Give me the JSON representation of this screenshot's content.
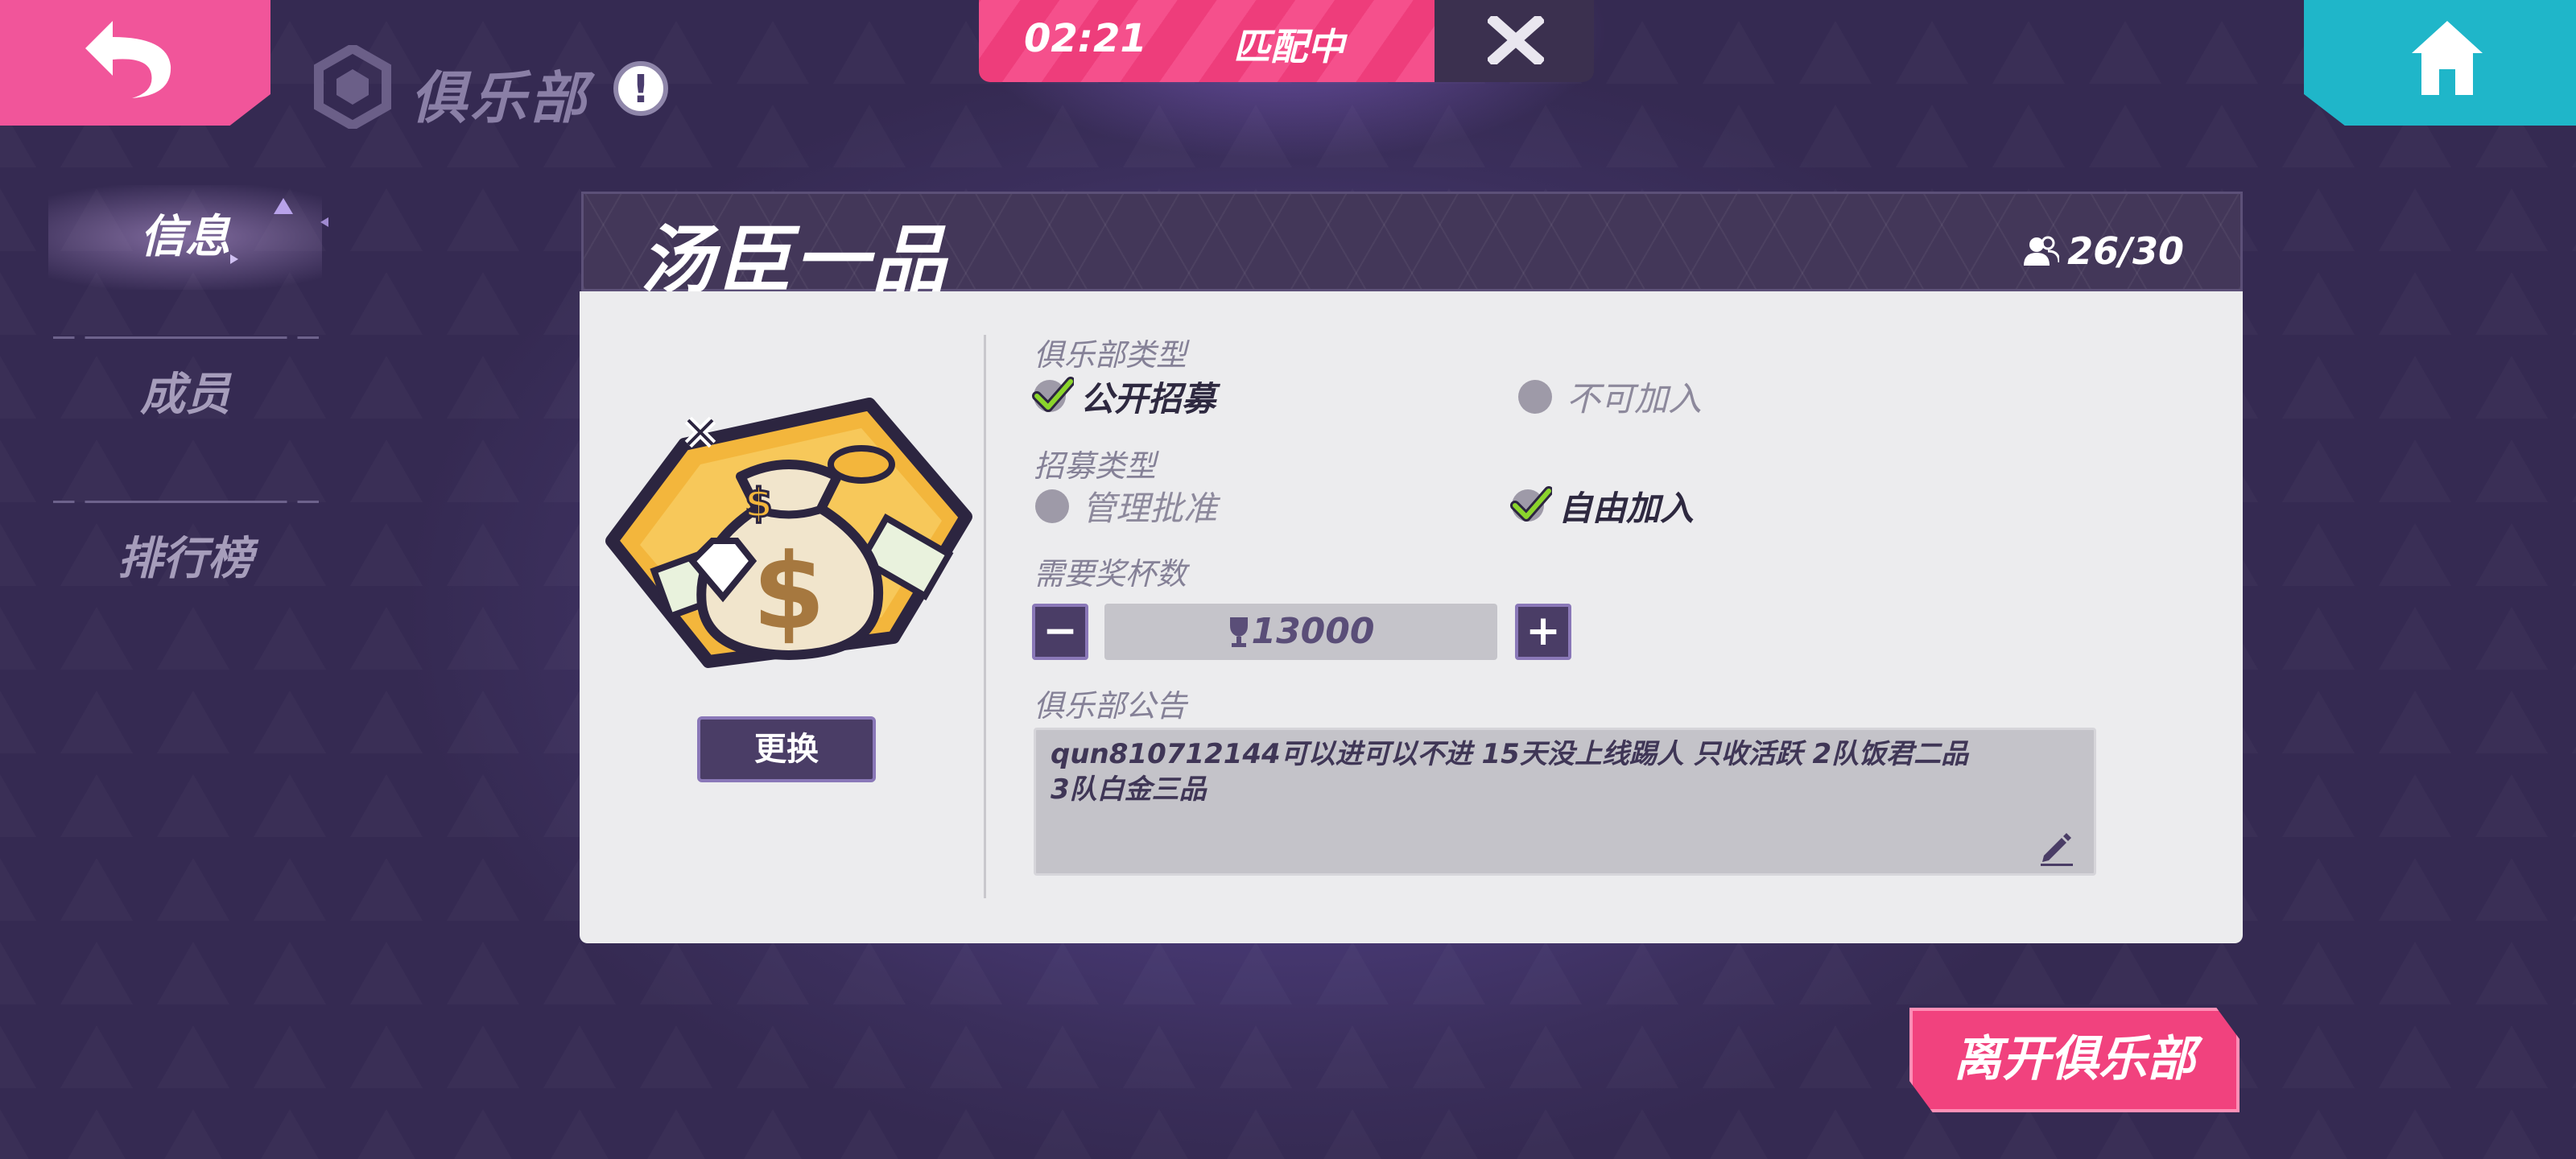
{
  "header": {
    "title": "俱乐部",
    "info_glyph": "!"
  },
  "match": {
    "time": "02:21",
    "status": "匹配中",
    "close_glyph": "✕"
  },
  "sidebar": {
    "items": [
      {
        "label": "信息",
        "active": true
      },
      {
        "label": "成员",
        "active": false
      },
      {
        "label": "排行榜",
        "active": false
      }
    ]
  },
  "club": {
    "name": "汤臣一品",
    "members": "26/30",
    "change_label": "更换",
    "club_type_label": "俱乐部类型",
    "club_type_options": [
      {
        "label": "公开招募",
        "selected": true
      },
      {
        "label": "不可加入",
        "selected": false
      }
    ],
    "recruit_type_label": "招募类型",
    "recruit_type_options": [
      {
        "label": "管理批准",
        "selected": false
      },
      {
        "label": "自由加入",
        "selected": true
      }
    ],
    "trophy_label": "需要奖杯数",
    "trophy_value": "13000",
    "minus_label": "−",
    "plus_label": "+",
    "notice_label": "俱乐部公告",
    "notice_text": "qun810712144可以进可以不进 15天没上线踢人 只收活跃 2队饭君二品\n3队白金三品"
  },
  "leave_label": "离开俱乐部",
  "colors": {
    "accent_pink": "#f1559a",
    "accent_cyan": "#1fb6c9",
    "check_green": "#8bd42c"
  }
}
